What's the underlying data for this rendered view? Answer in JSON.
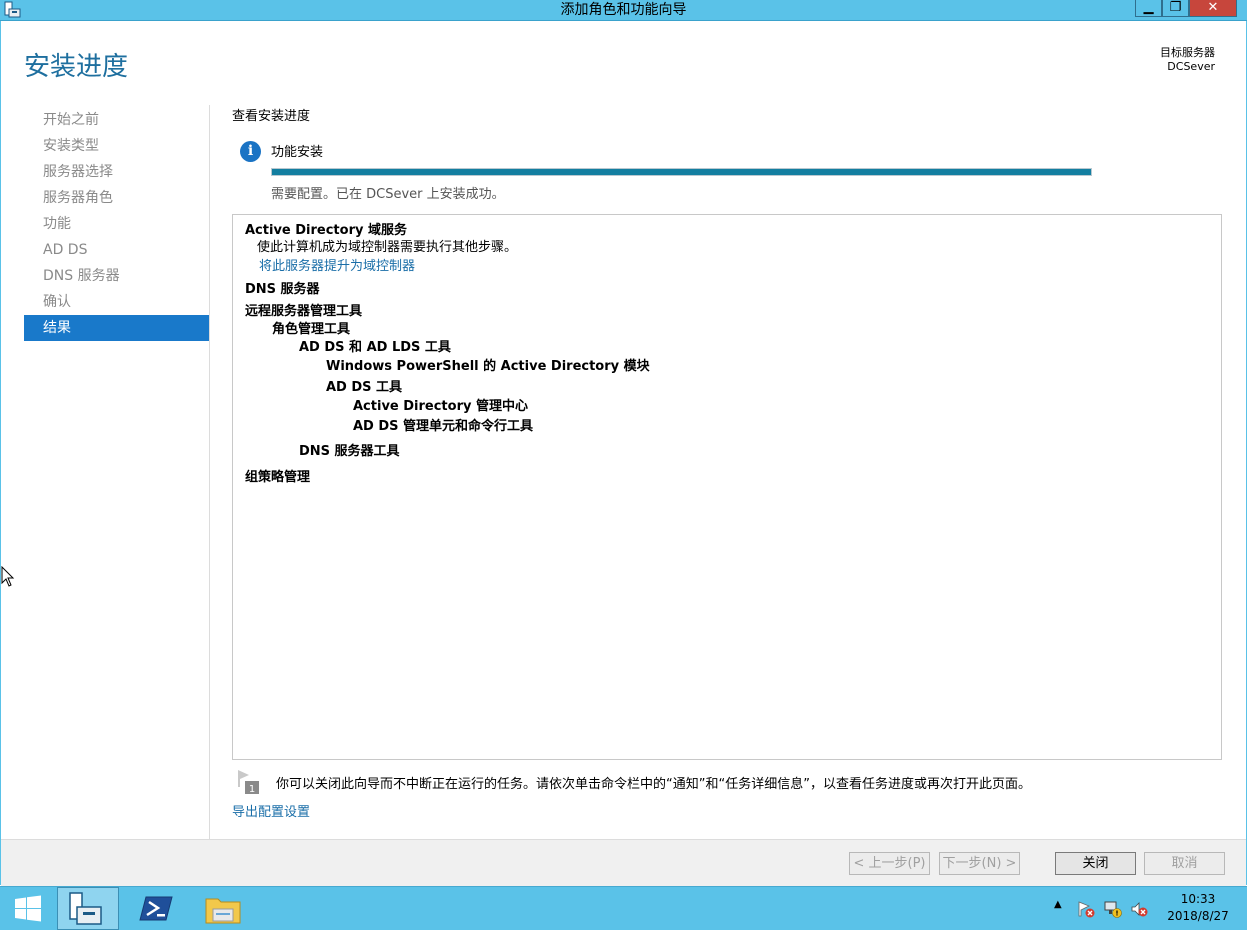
{
  "window": {
    "title": "添加角色和功能向导",
    "min_symbol": "▁",
    "max_symbol": "❐",
    "close_symbol": "✕"
  },
  "header": {
    "page_title": "安装进度",
    "target_label": "目标服务器",
    "target_name": "DCSever"
  },
  "nav": {
    "items": [
      {
        "label": "开始之前"
      },
      {
        "label": "安装类型"
      },
      {
        "label": "服务器选择"
      },
      {
        "label": "服务器角色"
      },
      {
        "label": "功能"
      },
      {
        "label": "AD DS"
      },
      {
        "label": "DNS 服务器"
      },
      {
        "label": "确认"
      },
      {
        "label": "结果"
      }
    ],
    "active_index": 8
  },
  "content": {
    "section_title": "查看安装进度",
    "info_icon_glyph": "i",
    "progress_label": "功能安装",
    "progress_fraction": 1.0,
    "status_text": "需要配置。已在 DCSever 上安装成功。",
    "results": [
      {
        "text": "Active Directory 域服务",
        "style": "bold"
      },
      {
        "text": "使此计算机成为域控制器需要执行其他步骤。",
        "style": "normal"
      },
      {
        "text": "将此服务器提升为域控制器",
        "style": "link"
      },
      {
        "text": "DNS 服务器",
        "style": "bold"
      },
      {
        "text": "远程服务器管理工具",
        "style": "bold"
      },
      {
        "text": "角色管理工具",
        "style": "bold"
      },
      {
        "text": "AD DS 和 AD LDS 工具",
        "style": "bold"
      },
      {
        "text": "Windows PowerShell 的 Active Directory 模块",
        "style": "bold"
      },
      {
        "text": "AD DS 工具",
        "style": "bold"
      },
      {
        "text": "Active Directory 管理中心",
        "style": "bold"
      },
      {
        "text": "AD DS 管理单元和命令行工具",
        "style": "bold"
      },
      {
        "text": "DNS 服务器工具",
        "style": "bold"
      },
      {
        "text": "组策略管理",
        "style": "bold"
      }
    ],
    "note_icon_number": "1",
    "note_text": "你可以关闭此向导而不中断正在运行的任务。请依次单击命令栏中的“通知”和“任务详细信息”，以查看任务进度或再次打开此页面。",
    "export_link": "导出配置设置"
  },
  "footer": {
    "prev_label": "< 上一步(P)",
    "next_label": "下一步(N) >",
    "close_label": "关闭",
    "cancel_label": "取消"
  },
  "taskbar": {
    "tray_arrow": "▲",
    "time": "10:33",
    "date": "2018/8/27"
  },
  "colors": {
    "titlebar": "#5ac2e8",
    "accent": "#1979ca",
    "title_text": "#1e6f9f",
    "progress_fill": "#137ea0",
    "link": "#1a6ea8"
  }
}
